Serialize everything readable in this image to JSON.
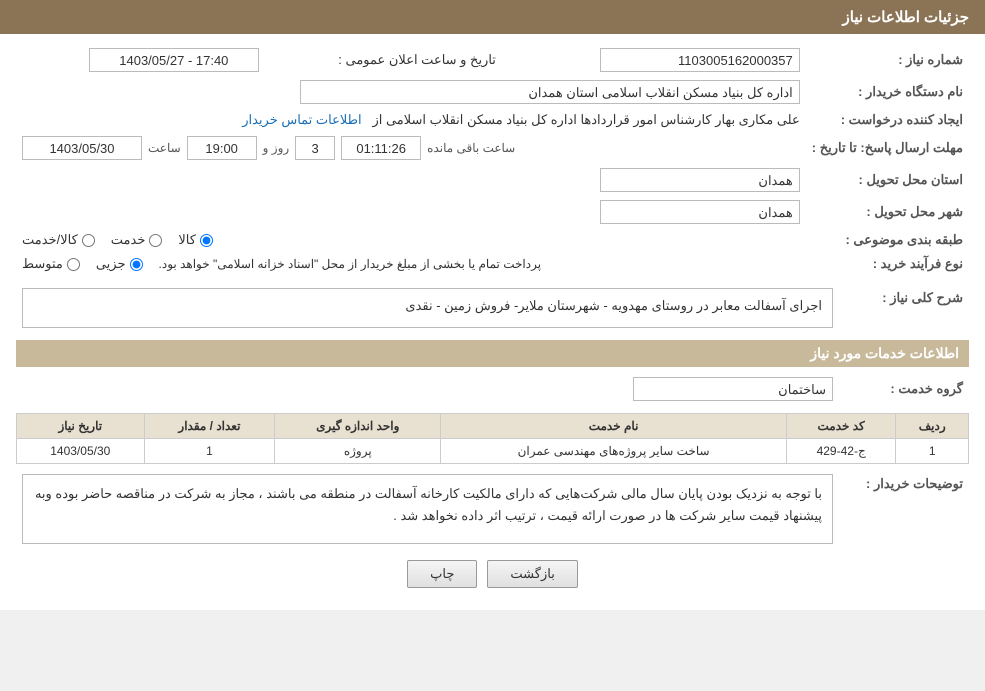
{
  "header": {
    "title": "جزئیات اطلاعات نیاز"
  },
  "fields": {
    "shomareNiaz_label": "شماره نیاز :",
    "shomareNiaz_value": "1103005162000357",
    "namDastgah_label": "نام دستگاه خریدار :",
    "namDastgah_value": "اداره کل بنیاد مسکن انقلاب اسلامی استان همدان",
    "ijadKonande_label": "ایجاد کننده درخواست :",
    "ijadKonande_value": "علی مکاری بهار کارشناس امور قراردادها اداره کل بنیاد مسکن انقلاب اسلامی از",
    "etelaat_link": "اطلاعات تماس خریدار",
    "mohlatErsalPasokh_label": "مهلت ارسال پاسخ: تا تاریخ :",
    "mohlat_date": "1403/05/30",
    "mohlat_time_label": "ساعت",
    "mohlat_time": "19:00",
    "mohlat_roz_label": "روز و",
    "mohlat_roz": "3",
    "mohlat_remaining_label": "ساعت باقی مانده",
    "mohlat_remaining": "01:11:26",
    "ostandMahal_label": "استان محل تحویل :",
    "ostandMahal_value": "همدان",
    "shahrMahal_label": "شهر محل تحویل :",
    "shahrMahal_value": "همدان",
    "tabaqeBandi_label": "طبقه بندی موضوعی :",
    "kala_label": "کالا",
    "khedmat_label": "خدمت",
    "kalaKhedmat_label": "کالا/خدمت",
    "noFarayand_label": "نوع فرآیند خرید :",
    "jozi_label": "جزیی",
    "mottaset_label": "متوسط",
    "farayand_desc": "پرداخت تمام یا بخشی از مبلغ خریدار از محل \"اسناد خزانه اسلامی\" خواهد بود.",
    "taarikh_eLan_label": "تاریخ و ساعت اعلان عمومی :",
    "taarikh_eLan_value": "1403/05/27 - 17:40",
    "sharhKoli_label": "شرح کلی نیاز :",
    "sharhKoli_value": "اجرای آسفالت معابر در روستای مهدویه - شهرستان ملایر- فروش زمین - نقدی",
    "khadamat_title": "اطلاعات خدمات مورد نیاز",
    "gohKhadamat_label": "گروه خدمت :",
    "gohKhadamat_value": "ساختمان",
    "table": {
      "headers": [
        "ردیف",
        "کد خدمت",
        "نام خدمت",
        "واحد اندازه گیری",
        "تعداد / مقدار",
        "تاریخ نیاز"
      ],
      "rows": [
        {
          "radif": "1",
          "kodKhadamat": "ج-42-429",
          "namKhadamat": "ساخت سایر پروژه‌های مهندسی عمران",
          "vahed": "پروژه",
          "tedad": "1",
          "tarikh": "1403/05/30"
        }
      ]
    },
    "tosihKharidar_label": "توضیحات خریدار :",
    "tosihKharidar_value": "با توجه به نزدیک بودن پایان سال مالی شرکت‌هایی که دارای مالکیت کارخانه آسفالت در منطقه می باشند ، مجاز به شرکت در مناقصه حاضر بوده وبه پیشنهاد قیمت سایر شرکت ها در صورت ارائه قیمت ، ترتیب اثر داده نخواهد شد ."
  },
  "buttons": {
    "chap": "چاپ",
    "bazgasht": "بازگشت"
  }
}
